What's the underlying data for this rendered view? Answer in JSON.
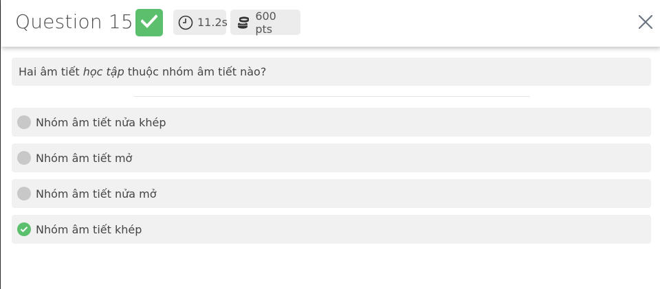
{
  "header": {
    "question_title": "Question 15",
    "status_icon": "check-icon",
    "time_label": "11.2s",
    "points_label": "600 pts",
    "close_icon": "close-icon"
  },
  "question": {
    "prefix": "Hai âm tiết",
    "emphasis": "học tập",
    "suffix": "thuộc nhóm âm tiết nào?"
  },
  "options": [
    {
      "label": "Nhóm âm tiết nửa khép",
      "selected": false
    },
    {
      "label": "Nhóm âm tiết mở",
      "selected": false
    },
    {
      "label": "Nhóm âm tiết nửa mở",
      "selected": false
    },
    {
      "label": "Nhóm âm tiết khép",
      "selected": true
    }
  ],
  "colors": {
    "correct": "#5cbf6d",
    "unselected": "#c8c8c8",
    "option_bg": "#f1f1f1",
    "chip_bg": "#ececec"
  }
}
